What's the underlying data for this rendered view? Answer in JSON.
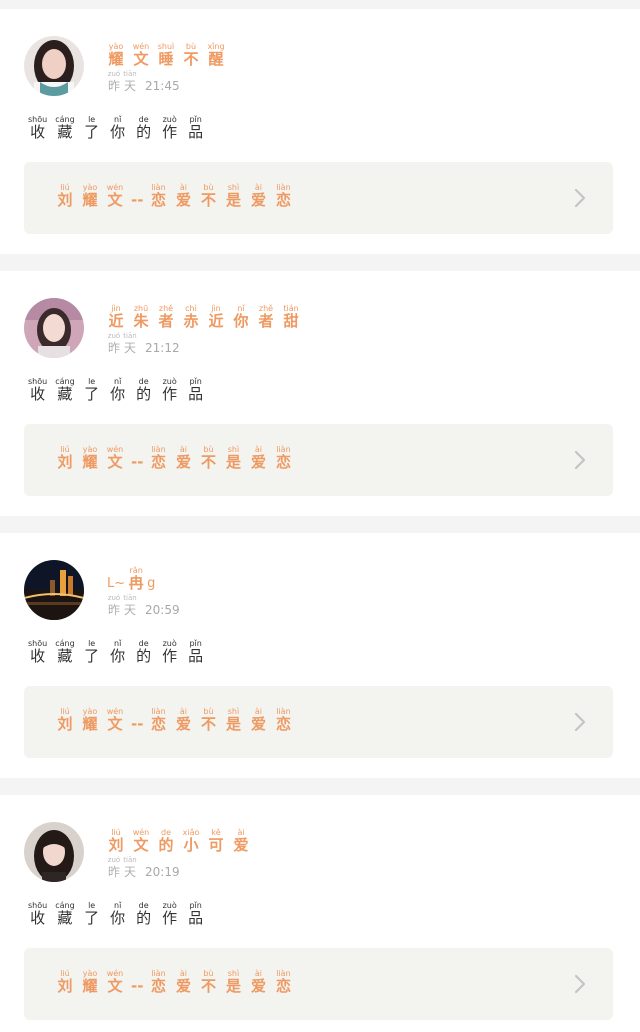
{
  "colors": {
    "accent": "#ef9a62",
    "text": "#333333",
    "muted": "#b0b0b0",
    "card_bg": "#f3f3ef",
    "page_bg": "#f5f4f4"
  },
  "items": [
    {
      "user": [
        {
          "py": "yào",
          "hz": "耀"
        },
        {
          "py": "wén",
          "hz": "文"
        },
        {
          "py": "shuì",
          "hz": "睡"
        },
        {
          "py": "bù",
          "hz": "不"
        },
        {
          "py": "xǐng",
          "hz": "醒"
        }
      ],
      "date": [
        {
          "py": "zuó",
          "hz": "昨"
        },
        {
          "py": "tiān",
          "hz": "天"
        }
      ],
      "time": "21:45",
      "action": [
        {
          "py": "shōu",
          "hz": "收"
        },
        {
          "py": "cáng",
          "hz": "藏"
        },
        {
          "py": "le",
          "hz": "了"
        },
        {
          "py": "nǐ",
          "hz": "你"
        },
        {
          "py": "de",
          "hz": "的"
        },
        {
          "py": "zuò",
          "hz": "作"
        },
        {
          "py": "pǐn",
          "hz": "品"
        }
      ],
      "avatar": "avatar-girl-1"
    },
    {
      "user": [
        {
          "py": "jìn",
          "hz": "近"
        },
        {
          "py": "zhū",
          "hz": "朱"
        },
        {
          "py": "zhě",
          "hz": "者"
        },
        {
          "py": "chì",
          "hz": "赤"
        },
        {
          "py": "jìn",
          "hz": "近"
        },
        {
          "py": "nǐ",
          "hz": "你"
        },
        {
          "py": "zhě",
          "hz": "者"
        },
        {
          "py": "tián",
          "hz": "甜"
        }
      ],
      "date": [
        {
          "py": "zuó",
          "hz": "昨"
        },
        {
          "py": "tiān",
          "hz": "天"
        }
      ],
      "time": "21:12",
      "action": [
        {
          "py": "shōu",
          "hz": "收"
        },
        {
          "py": "cáng",
          "hz": "藏"
        },
        {
          "py": "le",
          "hz": "了"
        },
        {
          "py": "nǐ",
          "hz": "你"
        },
        {
          "py": "de",
          "hz": "的"
        },
        {
          "py": "zuò",
          "hz": "作"
        },
        {
          "py": "pǐn",
          "hz": "品"
        }
      ],
      "avatar": "avatar-girl-2"
    },
    {
      "user_prefix": "L~",
      "user": [
        {
          "py": "rǎn",
          "hz": "冉"
        }
      ],
      "user_suffix": "g",
      "date": [
        {
          "py": "zuó",
          "hz": "昨"
        },
        {
          "py": "tiān",
          "hz": "天"
        }
      ],
      "time": "20:59",
      "action": [
        {
          "py": "shōu",
          "hz": "收"
        },
        {
          "py": "cáng",
          "hz": "藏"
        },
        {
          "py": "le",
          "hz": "了"
        },
        {
          "py": "nǐ",
          "hz": "你"
        },
        {
          "py": "de",
          "hz": "的"
        },
        {
          "py": "zuò",
          "hz": "作"
        },
        {
          "py": "pǐn",
          "hz": "品"
        }
      ],
      "avatar": "avatar-city-night"
    },
    {
      "user": [
        {
          "py": "liú",
          "hz": "刘"
        },
        {
          "py": "wén",
          "hz": "文"
        },
        {
          "py": "de",
          "hz": "的"
        },
        {
          "py": "xiǎo",
          "hz": "小"
        },
        {
          "py": "kě",
          "hz": "可"
        },
        {
          "py": "ài",
          "hz": "爱"
        }
      ],
      "date": [
        {
          "py": "zuó",
          "hz": "昨"
        },
        {
          "py": "tiān",
          "hz": "天"
        }
      ],
      "time": "20:19",
      "action": [
        {
          "py": "shōu",
          "hz": "收"
        },
        {
          "py": "cáng",
          "hz": "藏"
        },
        {
          "py": "le",
          "hz": "了"
        },
        {
          "py": "nǐ",
          "hz": "你"
        },
        {
          "py": "de",
          "hz": "的"
        },
        {
          "py": "zuò",
          "hz": "作"
        },
        {
          "py": "pǐn",
          "hz": "品"
        }
      ],
      "avatar": "avatar-girl-3"
    }
  ],
  "work": {
    "part1": [
      {
        "py": "liú",
        "hz": "刘"
      },
      {
        "py": "yào",
        "hz": "耀"
      },
      {
        "py": "wén",
        "hz": "文"
      }
    ],
    "dash": "--",
    "part2": [
      {
        "py": "liàn",
        "hz": "恋"
      },
      {
        "py": "ài",
        "hz": "爱"
      },
      {
        "py": "bù",
        "hz": "不"
      },
      {
        "py": "shì",
        "hz": "是"
      },
      {
        "py": "ài",
        "hz": "爱"
      },
      {
        "py": "liàn",
        "hz": "恋"
      }
    ]
  },
  "icons": {
    "chevron": "chevron-right-icon"
  }
}
